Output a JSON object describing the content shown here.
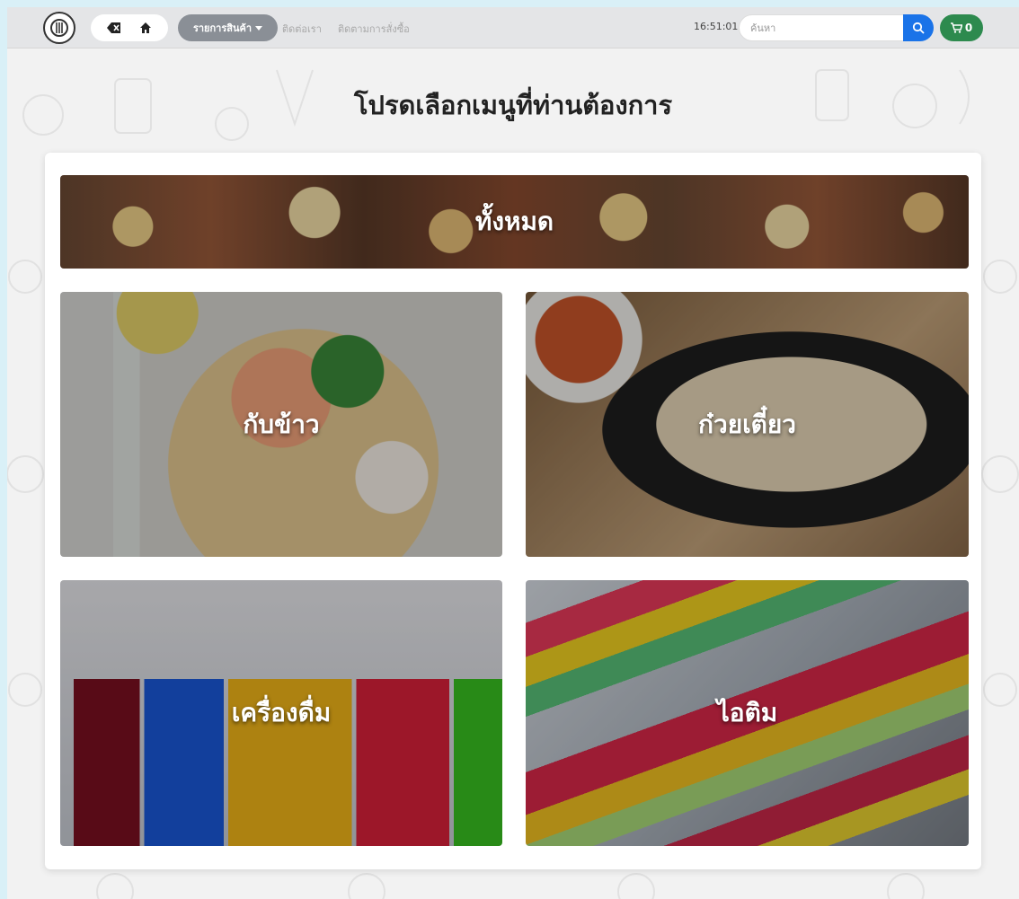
{
  "navbar": {
    "dropdown_label": "รายการสินค้า",
    "contact_label": "ติดต่อเรา",
    "track_label": "ติดตามการสั่งซื้อ",
    "clock": "16:51:01",
    "search_placeholder": "ค้นหา",
    "cart_count": "0"
  },
  "main": {
    "title": "โปรดเลือกเมนูที่ท่านต้องการ",
    "categories": [
      {
        "label": "ทั้งหมด"
      },
      {
        "label": "กับข้าว"
      },
      {
        "label": "ก๋วยเตี๋ยว"
      },
      {
        "label": "เครื่องดื่ม"
      },
      {
        "label": "ไอติม"
      }
    ]
  },
  "colors": {
    "search_button": "#1a73e8",
    "cart_button": "#2d8a4e",
    "dropdown": "#8a8f96"
  },
  "icons": [
    "logo-icon",
    "backspace-icon",
    "home-icon",
    "caret-down-icon",
    "search-icon",
    "cart-icon"
  ]
}
